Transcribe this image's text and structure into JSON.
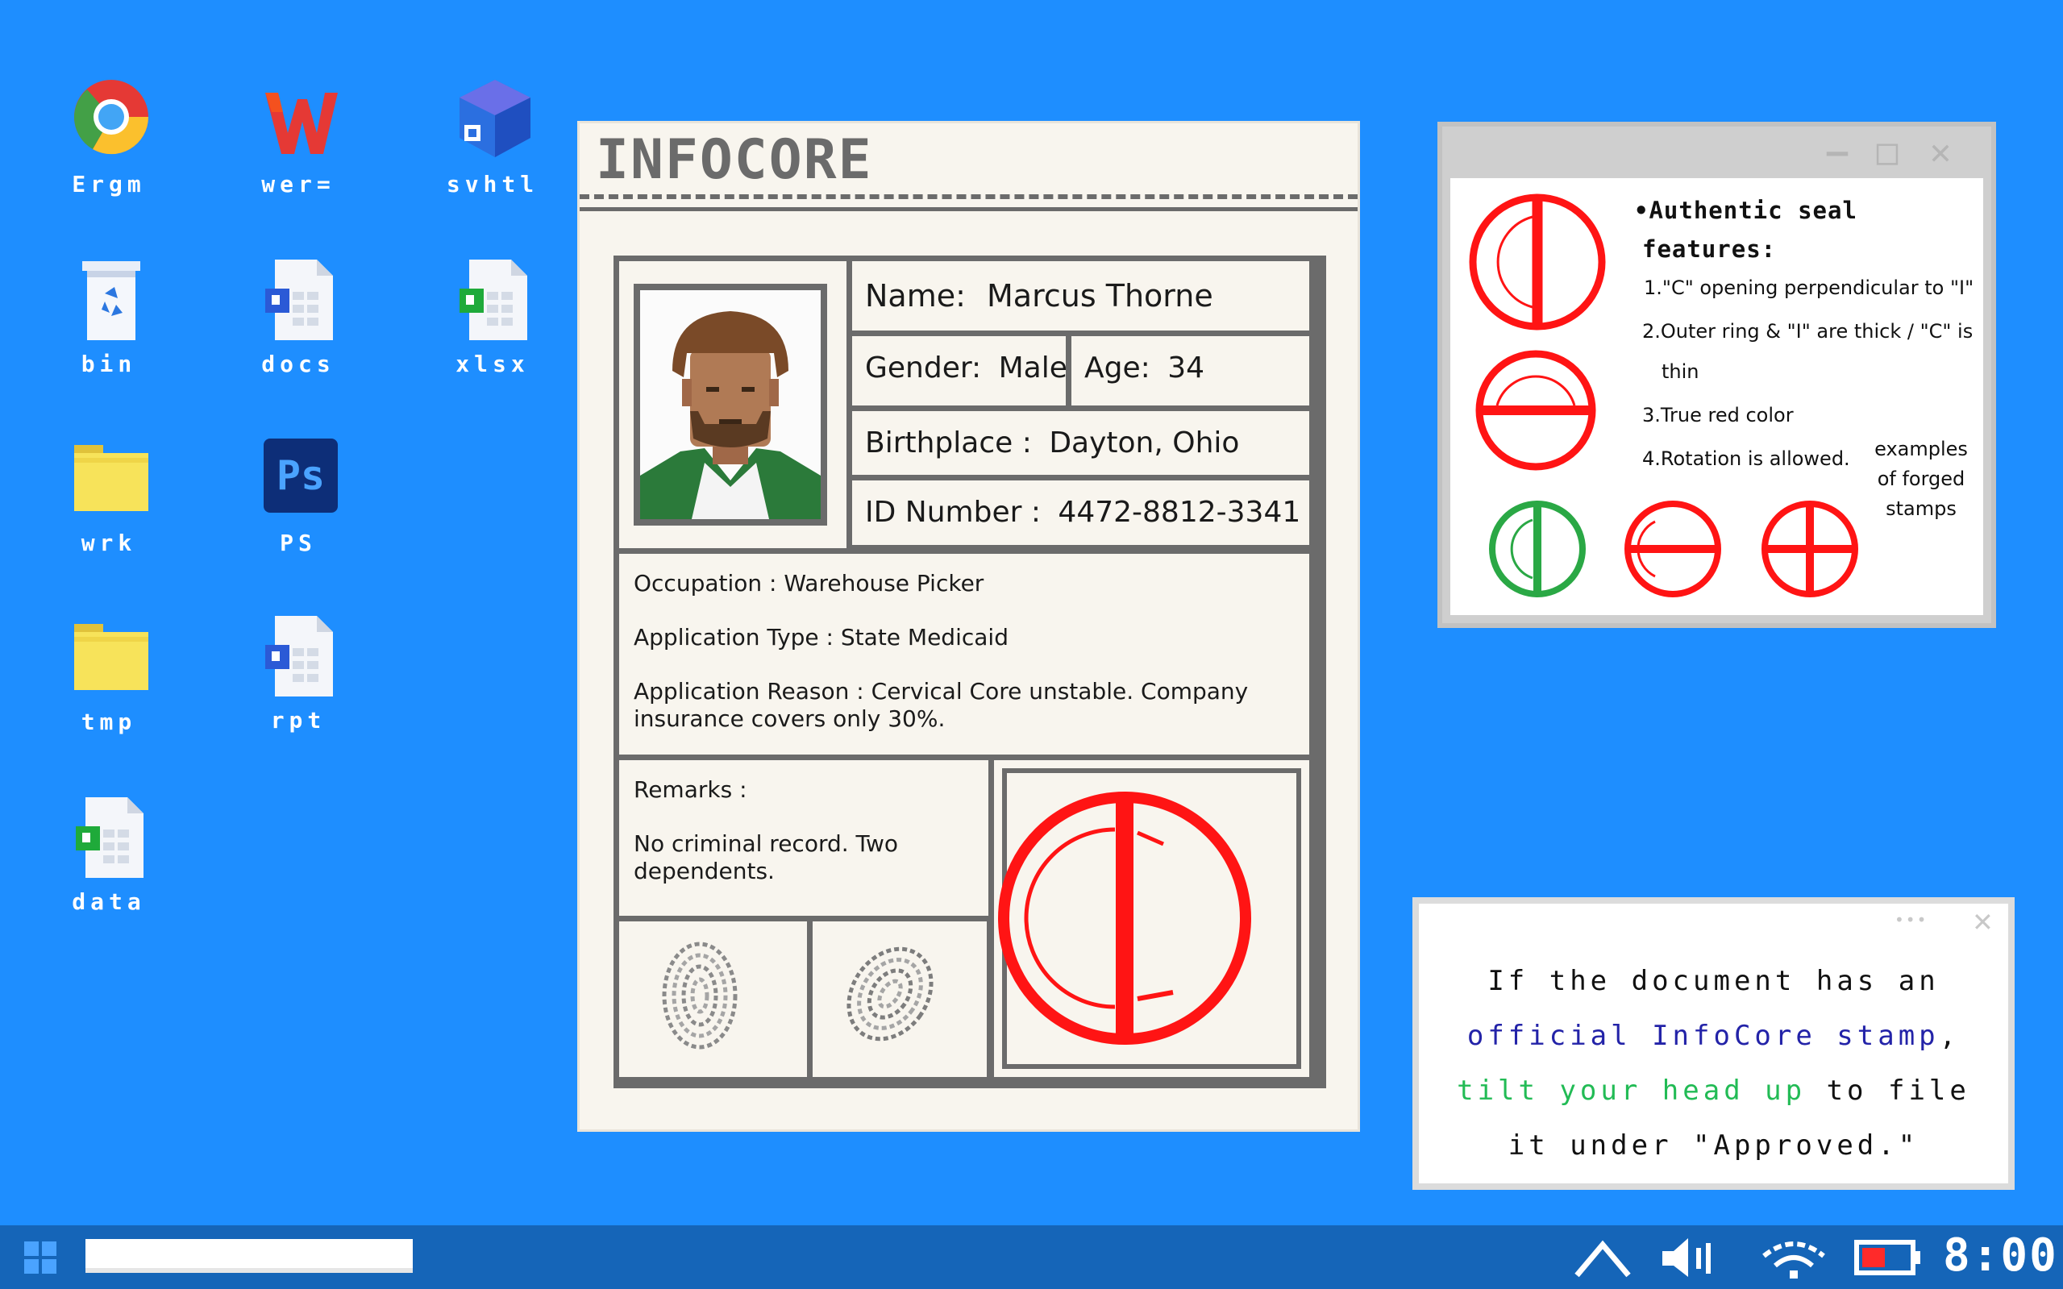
{
  "desktop": {
    "icons": [
      {
        "label": "Ergm",
        "icon": "browser-icon"
      },
      {
        "label": "wer=",
        "icon": "wps-icon"
      },
      {
        "label": "svhtl",
        "icon": "cube-app-icon"
      },
      {
        "label": "bin",
        "icon": "recycle-bin-icon"
      },
      {
        "label": "docs",
        "icon": "word-doc-icon"
      },
      {
        "label": "xlsx",
        "icon": "spreadsheet-icon"
      },
      {
        "label": "wrk",
        "icon": "folder-icon"
      },
      {
        "label": "PS",
        "icon": "photoshop-icon"
      },
      {
        "label": "tmp",
        "icon": "folder-icon"
      },
      {
        "label": "rpt",
        "icon": "word-doc-icon"
      },
      {
        "label": "data",
        "icon": "spreadsheet-icon"
      }
    ],
    "ps_glyph": "Ps"
  },
  "document": {
    "title": "INFOCORE",
    "name_label": "Name:",
    "name_value": "Marcus Thorne",
    "gender_label": "Gender:",
    "gender_value": "Male",
    "age_label": "Age:",
    "age_value": "34",
    "birthplace_label": "Birthplace :",
    "birthplace_value": "Dayton, Ohio",
    "id_label": "ID Number :",
    "id_value": "4472-8812-3341",
    "occupation_label": "Occupation :",
    "occupation_value": "Warehouse Picker",
    "app_type_label": "Application Type :",
    "app_type_value": "State Medicaid",
    "app_reason_label": "Application Reason :",
    "app_reason_value": "Cervical Core unstable. Company insurance covers only 30%.",
    "remarks_label": "Remarks :",
    "remarks_value": "No criminal record. Two dependents.",
    "stamp_color": "#ff1414"
  },
  "seal_window": {
    "minimize": "—",
    "maximize": "□",
    "close": "✕",
    "bullet": "•",
    "heading_line1": "Authentic seal",
    "heading_line2": "features:",
    "features": [
      "1.\"C\" opening perpendicular to \"I\"",
      "2.Outer ring & \"I\" are thick  / \"C\" is",
      "thin",
      "3.True red color",
      "4.Rotation is allowed."
    ],
    "forged_caption": [
      "examples",
      "of forged",
      "stamps"
    ],
    "forged_green_color": "#2aa845",
    "true_red_color": "#ff1414"
  },
  "hint": {
    "dots": "•••",
    "close": "✕",
    "line1": "If the document has an",
    "line2_blue": "official InfoCore stamp",
    "line2_tail": ",",
    "line3_green": "tilt your head up",
    "line3_tail": " to file",
    "line4": "it under \"Approved.\""
  },
  "taskbar": {
    "clock": "8:00",
    "tray": [
      "wifi-icon",
      "volume-icon",
      "network-icon",
      "battery-icon"
    ]
  }
}
